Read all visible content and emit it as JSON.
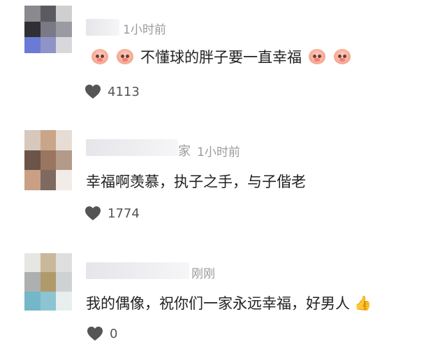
{
  "comments": [
    {
      "name_tail": "",
      "time": "1小时前",
      "text": "不懂球的胖子要一直幸福",
      "likes": "4113",
      "avatar_colors": [
        "#8a8a8e",
        "#5a5a60",
        "#cfcfd2",
        "#2f2f35",
        "#7a7a86",
        "#9a9aa2",
        "#6a7bd6",
        "#8e93c8",
        "#d8d8dc"
      ]
    },
    {
      "name_tail": "家",
      "time": "1小时前",
      "text": "幸福啊羡慕，执子之手，与子偕老",
      "likes": "1774",
      "avatar_colors": [
        "#d8c8bc",
        "#c9a58a",
        "#e6dcd4",
        "#6a5548",
        "#9a7560",
        "#b49a88",
        "#caa084",
        "#7e6a60",
        "#f2ece8"
      ]
    },
    {
      "name_tail": "",
      "time": "刚刚",
      "text": "我的偶像，祝你们一家永远幸福，好男人",
      "likes": "0",
      "avatar_colors": [
        "#e6e6e2",
        "#c9b89a",
        "#dedede",
        "#aeb0b0",
        "#b09a6c",
        "#cfd2d2",
        "#74b7c9",
        "#8cc4d2",
        "#e8eeee"
      ]
    }
  ],
  "icons": {
    "heart": "heart-icon",
    "reaction_emoji": "pig-face-emoji-icon",
    "thumbs_up": "thumbs-up-emoji-icon"
  },
  "colors": {
    "text": "#222222",
    "meta": "#9a9a9e",
    "heart": "#555558"
  }
}
